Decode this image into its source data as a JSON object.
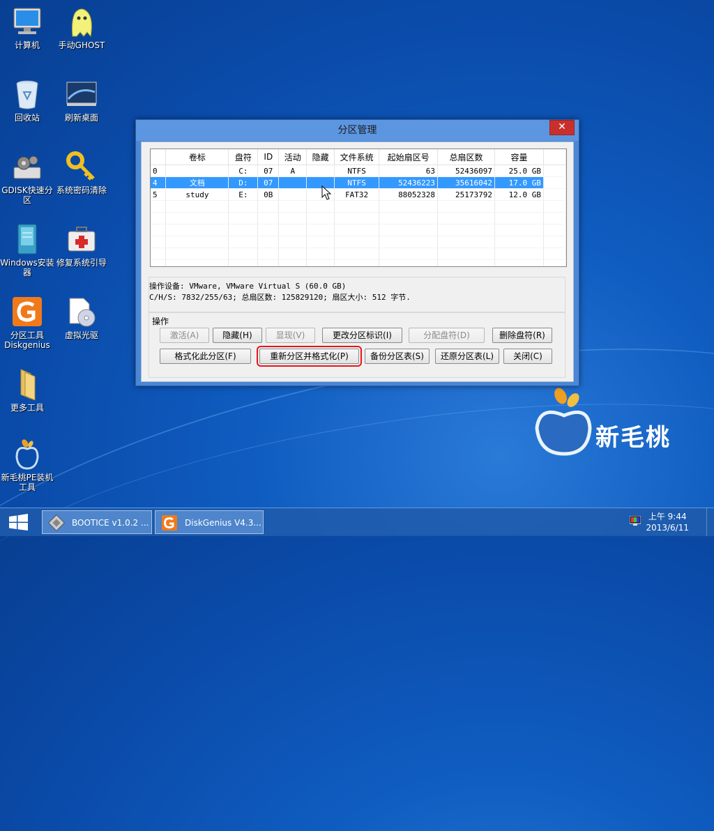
{
  "desktop": {
    "icons": [
      {
        "label": "计算机",
        "icon": "computer-icon"
      },
      {
        "label": "手动GHOST",
        "icon": "ghost-icon"
      },
      {
        "label": "回收站",
        "icon": "recycle-bin-icon"
      },
      {
        "label": "刷新桌面",
        "icon": "refresh-desktop-icon"
      },
      {
        "label": "GDISK快速分区",
        "icon": "gdisk-icon"
      },
      {
        "label": "系统密码清除",
        "icon": "key-icon"
      },
      {
        "label": "Windows安装器",
        "icon": "windows-installer-icon"
      },
      {
        "label": "修复系统引导",
        "icon": "first-aid-kit-icon"
      },
      {
        "label": "分区工具Diskgenius",
        "icon": "diskgenius-icon"
      },
      {
        "label": "虚拟光驱",
        "icon": "virtual-drive-icon"
      },
      {
        "label": "更多工具",
        "icon": "folder-icon"
      },
      {
        "label": "新毛桃PE装机工具",
        "icon": "peach-icon"
      }
    ]
  },
  "window": {
    "title": "分区管理",
    "close_label": "✕",
    "table": {
      "columns": [
        "卷标",
        "盘符",
        "ID",
        "活动",
        "隐藏",
        "文件系统",
        "起始扇区号",
        "总扇区数",
        "容量"
      ],
      "rows": [
        {
          "no": "0",
          "label": "",
          "drive": "C:",
          "id": "07",
          "active": "A",
          "hidden": "",
          "fs": "NTFS",
          "start": "63",
          "total": "52436097",
          "size": "25.0 GB",
          "selected": false
        },
        {
          "no": "4",
          "label": "文档",
          "drive": "D:",
          "id": "07",
          "active": "",
          "hidden": "",
          "fs": "NTFS",
          "start": "52436223",
          "total": "35616042",
          "size": "17.0 GB",
          "selected": true
        },
        {
          "no": "5",
          "label": "study",
          "drive": "E:",
          "id": "0B",
          "active": "",
          "hidden": "",
          "fs": "FAT32",
          "start": "88052328",
          "total": "25173792",
          "size": "12.0 GB",
          "selected": false
        }
      ]
    },
    "info": {
      "line1": "操作设备:  VMware, VMware Virtual S (60.0 GB)",
      "line2": "C/H/S: 7832/255/63; 总扇区数: 125829120; 扇区大小: 512 字节."
    },
    "ops": {
      "label": "操作",
      "activate": "激活(A)",
      "hide": "隐藏(H)",
      "show": "显现(V)",
      "change_id": "更改分区标识(I)",
      "assign_letter": "分配盘符(D)",
      "delete_letter": "删除盘符(R)",
      "format": "格式化此分区(F)",
      "repartition_format": "重新分区并格式化(P)",
      "backup_table": "备份分区表(S)",
      "restore_table": "还原分区表(L)",
      "close": "关闭(C)"
    }
  },
  "logo": {
    "text": "新毛桃"
  },
  "taskbar": {
    "tasks": [
      {
        "label": "BOOTICE v1.0.2 ...",
        "icon": "bootice-icon"
      },
      {
        "label": "DiskGenius V4.3...",
        "icon": "diskgenius-icon"
      }
    ],
    "time": "上午 9:44",
    "date": "2013/6/11"
  },
  "colors": {
    "selection": "#3399ff",
    "highlight": "#e8141b",
    "close": "#c9302c"
  }
}
